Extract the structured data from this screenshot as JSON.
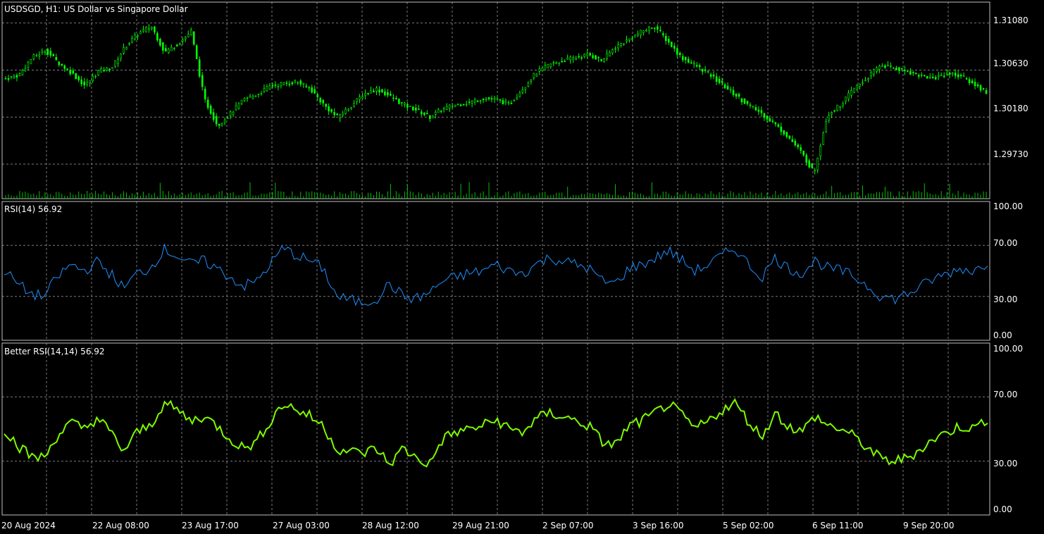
{
  "colors": {
    "background": "#000000",
    "grid": "#7a7a7a",
    "frame": "#c0c0c0",
    "candle": "#00ff00",
    "volume": "#00c000",
    "rsi_line": "#1e90ff",
    "better_rsi_line": "#7cfc00",
    "text": "#ffffff"
  },
  "chart_data": [
    {
      "type": "candlestick",
      "title": "USDSGD, H1:  US Dollar vs Singapore Dollar",
      "y_ticks": [
        "1.31080",
        "1.30630",
        "1.30180",
        "1.29730"
      ],
      "y_tick_values": [
        1.3108,
        1.3063,
        1.3018,
        1.2973
      ],
      "ylim": [
        1.294,
        1.3128
      ],
      "grid": true,
      "x_ticks": [
        "20 Aug 2024",
        "22 Aug 08:00",
        "23 Aug 17:00",
        "27 Aug 03:00",
        "28 Aug 12:00",
        "29 Aug 21:00",
        "2 Sep 07:00",
        "3 Sep 16:00",
        "5 Sep 02:00",
        "6 Sep 11:00",
        "9 Sep 20:00"
      ],
      "close_path": [
        1.3055,
        1.3058,
        1.3075,
        1.3082,
        1.307,
        1.306,
        1.3048,
        1.3062,
        1.3065,
        1.3085,
        1.3098,
        1.3105,
        1.308,
        1.3088,
        1.31,
        1.3035,
        1.301,
        1.3022,
        1.3035,
        1.304,
        1.3048,
        1.305,
        1.3052,
        1.3045,
        1.303,
        1.3018,
        1.3028,
        1.304,
        1.3045,
        1.3038,
        1.303,
        1.3025,
        1.3018,
        1.3026,
        1.303,
        1.3032,
        1.3036,
        1.3035,
        1.303,
        1.3045,
        1.306,
        1.3068,
        1.3072,
        1.3075,
        1.3078,
        1.3072,
        1.3085,
        1.3092,
        1.31,
        1.3105,
        1.309,
        1.3075,
        1.3068,
        1.306,
        1.305,
        1.304,
        1.303,
        1.3022,
        1.3012,
        1.3,
        1.2985,
        1.2965,
        1.302,
        1.303,
        1.3045,
        1.3055,
        1.3068,
        1.3065,
        1.3062,
        1.3058,
        1.3055,
        1.306,
        1.3058,
        1.305,
        1.3042
      ]
    },
    {
      "type": "line",
      "title": "RSI(14) 56.92",
      "y_ticks": [
        "100.00",
        "70.00",
        "30.00",
        "0.00"
      ],
      "y_tick_values": [
        100,
        70,
        30,
        0
      ],
      "ylim": [
        0,
        100
      ],
      "levels": [
        70,
        30
      ],
      "series": [
        {
          "values": [
            50,
            40,
            32,
            30,
            45,
            55,
            50,
            57,
            48,
            36,
            48,
            52,
            67,
            62,
            55,
            58,
            52,
            45,
            38,
            42,
            55,
            68,
            62,
            58,
            52,
            30,
            27,
            25,
            28,
            40,
            30,
            28,
            33,
            42,
            45,
            48,
            50,
            55,
            50,
            48,
            55,
            60,
            58,
            55,
            52,
            42,
            40,
            52,
            55,
            60,
            66,
            58,
            50,
            55,
            62,
            68,
            55,
            45,
            60,
            52,
            48,
            58,
            52,
            50,
            45,
            38,
            30,
            28,
            32,
            38,
            44,
            48,
            52,
            50,
            57
          ]
        }
      ]
    },
    {
      "type": "line",
      "title": "Better RSI(14,14) 56.92",
      "y_ticks": [
        "100.00",
        "70.00",
        "30.00",
        "0.00"
      ],
      "y_tick_values": [
        100,
        70,
        30,
        0
      ],
      "ylim": [
        0,
        100
      ],
      "levels": [
        70,
        30
      ],
      "series": [
        {
          "values": [
            50,
            40,
            33,
            32,
            46,
            54,
            50,
            57,
            48,
            36,
            48,
            52,
            66,
            62,
            55,
            58,
            52,
            44,
            38,
            42,
            55,
            66,
            62,
            58,
            52,
            38,
            36,
            35,
            38,
            28,
            38,
            32,
            28,
            44,
            48,
            50,
            52,
            56,
            50,
            48,
            56,
            60,
            58,
            55,
            52,
            42,
            40,
            52,
            55,
            60,
            66,
            58,
            50,
            55,
            62,
            66,
            55,
            45,
            60,
            52,
            48,
            58,
            52,
            50,
            45,
            38,
            31,
            30,
            32,
            38,
            44,
            48,
            52,
            50,
            57
          ]
        }
      ]
    }
  ]
}
